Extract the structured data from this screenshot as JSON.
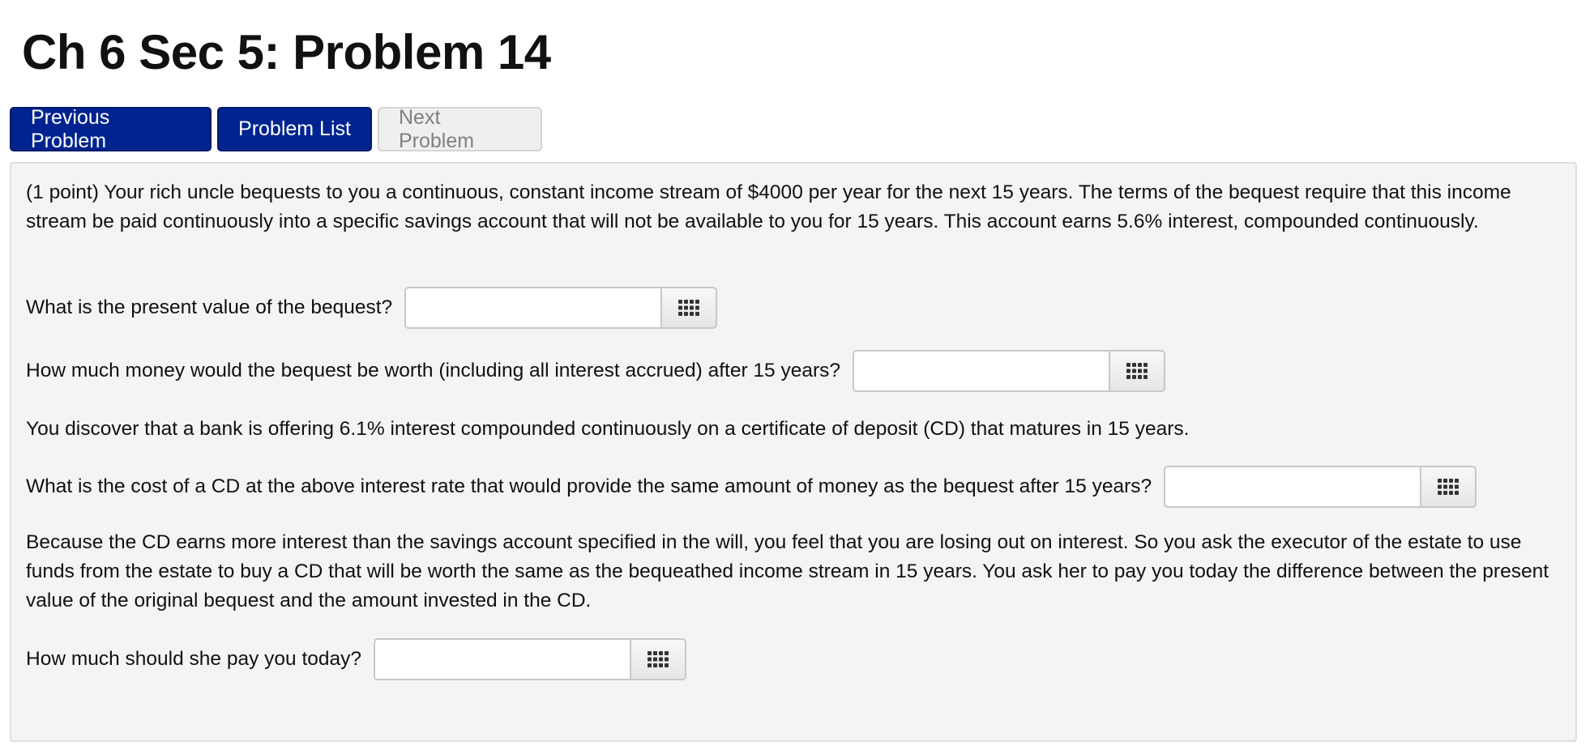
{
  "header": {
    "title": "Ch 6 Sec 5: Problem 14"
  },
  "nav": {
    "previous_label": "Previous Problem",
    "list_label": "Problem List",
    "next_label": "Next Problem"
  },
  "problem": {
    "intro": "(1 point) Your rich uncle bequests to you a continuous, constant income stream of $4000 per year for the next 15 years. The terms of the bequest require that this income stream be paid continuously into a specific savings account that will not be available to you for 15 years. This account earns 5.6% interest, compounded continuously.",
    "q1": "What is the present value of the bequest?",
    "q2": "How much money would the bequest be worth (including all interest accrued) after 15 years?",
    "info": "You discover that a bank is offering 6.1% interest compounded continuously on a certificate of deposit (CD) that matures in 15 years.",
    "q3": "What is the cost of a CD at the above interest rate that would provide the same amount of money as the bequest after 15 years?",
    "explanation": "Because the CD earns more interest than the savings account specified in the will, you feel that you are losing out on interest. So you ask the executor of the estate to use funds from the estate to buy a CD that will be worth the same as the bequeathed income stream in 15 years. You ask her to pay you today the difference between the present value of the original bequest and the amount invested in the CD.",
    "q4": "How much should she pay you today?",
    "answers": [
      "",
      "",
      "",
      ""
    ]
  },
  "icons": {
    "keypad": "keypad-grid-icon"
  },
  "colors": {
    "primary_button": "#00248f",
    "problem_background": "#f4f4f4"
  }
}
